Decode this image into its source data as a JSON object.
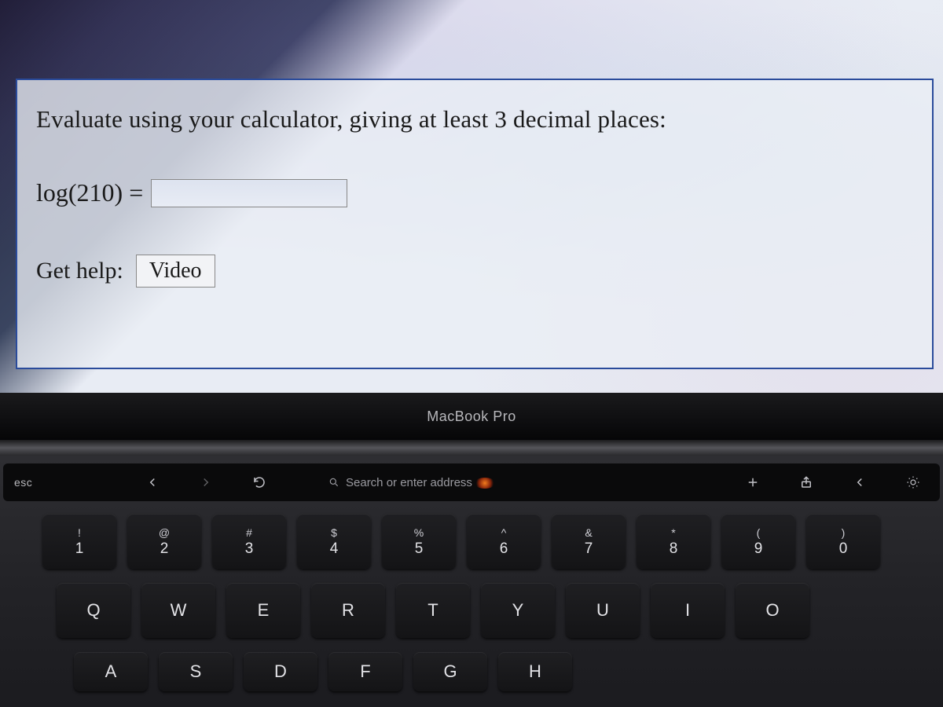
{
  "question": {
    "prompt": "Evaluate using your calculator, giving at least 3 decimal places:",
    "equation": "log(210) =",
    "answer_value": "",
    "help_label": "Get help:",
    "video_label": "Video"
  },
  "laptop": {
    "model_label": "MacBook Pro"
  },
  "touchbar": {
    "esc": "esc",
    "search_placeholder": "Search or enter address"
  },
  "keys": {
    "num_row": [
      {
        "upper": "!",
        "lower": "1"
      },
      {
        "upper": "@",
        "lower": "2"
      },
      {
        "upper": "#",
        "lower": "3"
      },
      {
        "upper": "$",
        "lower": "4"
      },
      {
        "upper": "%",
        "lower": "5"
      },
      {
        "upper": "^",
        "lower": "6"
      },
      {
        "upper": "&",
        "lower": "7"
      },
      {
        "upper": "*",
        "lower": "8"
      },
      {
        "upper": "(",
        "lower": "9"
      },
      {
        "upper": ")",
        "lower": "0"
      }
    ],
    "qwe_row": [
      "Q",
      "W",
      "E",
      "R",
      "T",
      "Y",
      "U",
      "I",
      "O"
    ],
    "asd_row": [
      "A",
      "S",
      "D",
      "F",
      "G",
      "H"
    ]
  }
}
